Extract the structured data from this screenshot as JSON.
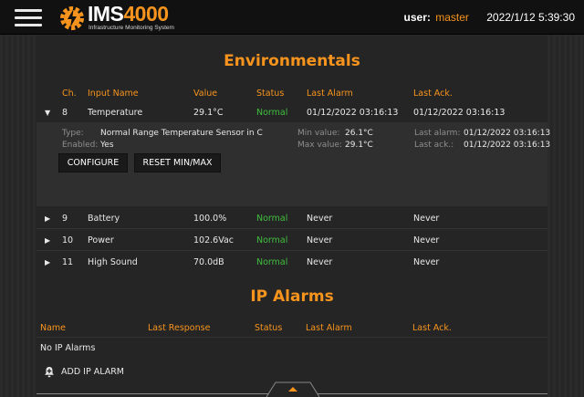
{
  "header": {
    "logo": {
      "ims": "IMS",
      "num": "4000",
      "subtitle": "Infrastructure Monitoring System"
    },
    "user_label": "user:",
    "user_name": "master",
    "datetime": "2022/1/12 5:39:30"
  },
  "environmentals": {
    "title": "Environmentals",
    "columns": {
      "ch": "Ch.",
      "input": "Input Name",
      "value": "Value",
      "status": "Status",
      "last_alarm": "Last Alarm",
      "last_ack": "Last Ack."
    },
    "rows": [
      {
        "ch": "8",
        "name": "Temperature",
        "value": "29.1°C",
        "status": "Normal",
        "last_alarm": "01/12/2022 03:16:13",
        "last_ack": "01/12/2022 03:16:13"
      },
      {
        "ch": "9",
        "name": "Battery",
        "value": "100.0%",
        "status": "Normal",
        "last_alarm": "Never",
        "last_ack": "Never"
      },
      {
        "ch": "10",
        "name": "Power",
        "value": "102.6Vac",
        "status": "Normal",
        "last_alarm": "Never",
        "last_ack": "Never"
      },
      {
        "ch": "11",
        "name": "High Sound",
        "value": "70.0dB",
        "status": "Normal",
        "last_alarm": "Never",
        "last_ack": "Never"
      }
    ],
    "detail": {
      "type_label": "Type:",
      "type_value": "Normal Range Temperature Sensor in C",
      "enabled_label": "Enabled:",
      "enabled_value": "Yes",
      "min_label": "Min value:",
      "min_value": "26.1°C",
      "max_label": "Max value:",
      "max_value": "29.1°C",
      "last_alarm_label": "Last alarm:",
      "last_alarm_value": "01/12/2022 03:16:13",
      "last_ack_label": "Last ack.:",
      "last_ack_value": "01/12/2022 03:16:13",
      "configure_label": "CONFIGURE",
      "reset_label": "RESET MIN/MAX"
    }
  },
  "ip_alarms": {
    "title": "IP Alarms",
    "columns": {
      "name": "Name",
      "last_response": "Last Response",
      "status": "Status",
      "last_alarm": "Last Alarm",
      "last_ack": "Last Ack."
    },
    "empty_text": "No IP Alarms",
    "add_label": "ADD IP ALARM"
  },
  "colors": {
    "accent": "#f7941d",
    "ok": "#3fbf3f",
    "background": "#252525"
  },
  "icons": {
    "menu": "hamburger-icon",
    "logo": "gear-logo-icon",
    "expand": "triangle-icon",
    "add": "alarm-bell-icon",
    "scroll": "chevron-up-icon"
  }
}
